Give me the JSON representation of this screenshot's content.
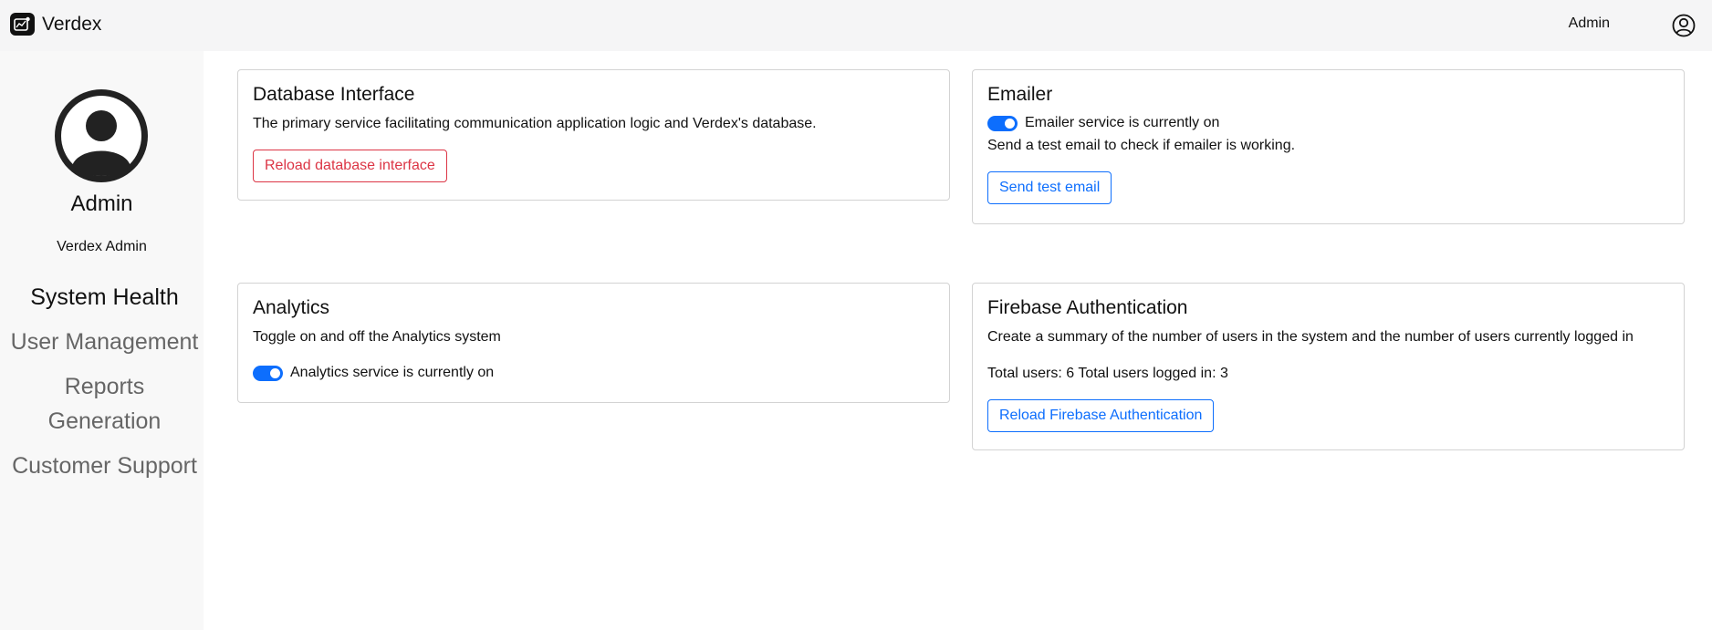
{
  "app": {
    "name": "Verdex"
  },
  "header": {
    "user_label": "Admin"
  },
  "sidebar": {
    "profile_name": "Admin",
    "profile_role": "Verdex Admin",
    "nav": {
      "system_health": "System Health",
      "user_management": "User Management",
      "reports_line1": "Reports",
      "reports_line2": "Generation",
      "customer_support": "Customer Support"
    }
  },
  "cards": {
    "database": {
      "title": "Database Interface",
      "description": "The primary service facilitating communication application logic and Verdex's database.",
      "button": "Reload database interface"
    },
    "emailer": {
      "title": "Emailer",
      "toggle_label": "Emailer service is currently on",
      "toggle_on": true,
      "description": "Send a test email to check if emailer is working.",
      "button": "Send test email"
    },
    "analytics": {
      "title": "Analytics",
      "description": "Toggle on and off the Analytics system",
      "toggle_label": "Analytics service is currently on",
      "toggle_on": true
    },
    "firebase": {
      "title": "Firebase Authentication",
      "description": "Create a summary of the number of users in the system and the number of users currently logged in",
      "stats": "Total users: 6 Total users logged in: 3",
      "button": "Reload Firebase Authentication"
    }
  },
  "colors": {
    "accent": "#0d6efd",
    "danger": "#dc3545",
    "sidebar_bg": "#f8f8f8",
    "header_bg": "#f5f5f6"
  }
}
